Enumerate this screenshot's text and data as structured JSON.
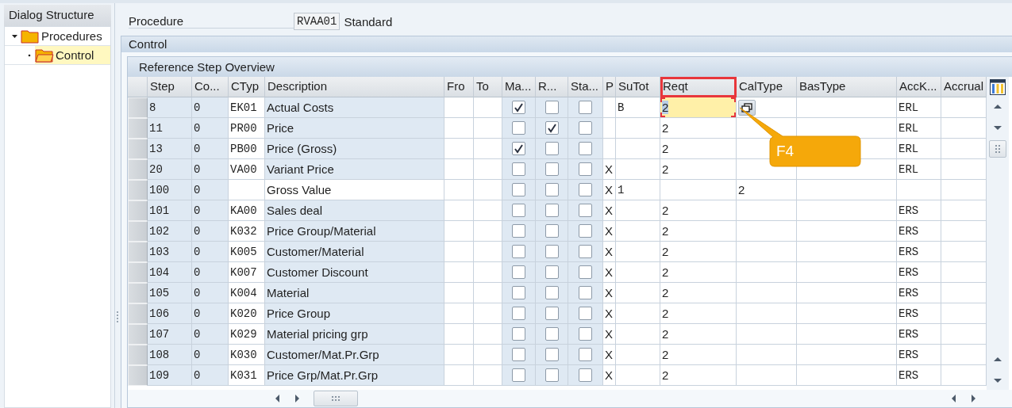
{
  "dialog_structure": {
    "title": "Dialog Structure",
    "items": [
      {
        "label": "Procedures",
        "expanded": true,
        "selected": false,
        "children": [
          {
            "label": "Control",
            "selected": true
          }
        ]
      }
    ]
  },
  "procedure": {
    "label": "Procedure",
    "value": "RVAA01",
    "description": "Standard"
  },
  "section_title": "Control",
  "table": {
    "title": "Reference Step Overview",
    "columns": [
      {
        "label": "Step",
        "kind": "mono",
        "editable": false,
        "highlighted": false
      },
      {
        "label": "Co...",
        "kind": "mono",
        "editable": false,
        "highlighted": false
      },
      {
        "label": "CTyp",
        "kind": "mono",
        "editable": true,
        "highlighted": false
      },
      {
        "label": "Description",
        "kind": "text",
        "editable": false,
        "highlighted": false
      },
      {
        "label": "Fro",
        "kind": "mono",
        "editable": true,
        "highlighted": false
      },
      {
        "label": "To",
        "kind": "mono",
        "editable": true,
        "highlighted": false
      },
      {
        "label": "Ma...",
        "kind": "check",
        "editable": false,
        "highlighted": false
      },
      {
        "label": "R...",
        "kind": "check",
        "editable": false,
        "highlighted": false
      },
      {
        "label": "Sta...",
        "kind": "check",
        "editable": false,
        "highlighted": false
      },
      {
        "label": "P",
        "kind": "text",
        "editable": true,
        "highlighted": false
      },
      {
        "label": "SuTot",
        "kind": "mono",
        "editable": true,
        "highlighted": false
      },
      {
        "label": "Reqt",
        "kind": "text",
        "editable": true,
        "highlighted": true
      },
      {
        "label": "CalType",
        "kind": "text",
        "editable": true,
        "highlighted": false
      },
      {
        "label": "BasType",
        "kind": "text",
        "editable": true,
        "highlighted": false
      },
      {
        "label": "AccK...",
        "kind": "mono",
        "editable": true,
        "highlighted": false
      },
      {
        "label": "Accrual",
        "kind": "text",
        "editable": true,
        "highlighted": false
      }
    ],
    "rows": [
      {
        "step": "8",
        "counter": "0",
        "ctyp": "EK01",
        "description": "Actual Costs",
        "description_editable": false,
        "manual": true,
        "required": false,
        "statistical": false,
        "subtotal": "B",
        "reqt": "2",
        "acckey": "ERL",
        "focused": true
      },
      {
        "step": "11",
        "counter": "0",
        "ctyp": "PR00",
        "description": "Price",
        "description_editable": false,
        "manual": false,
        "required": true,
        "statistical": false,
        "reqt": "2",
        "acckey": "ERL",
        "focused": false
      },
      {
        "step": "13",
        "counter": "0",
        "ctyp": "PB00",
        "description": "Price (Gross)",
        "description_editable": false,
        "manual": true,
        "required": false,
        "statistical": false,
        "reqt": "2",
        "acckey": "ERL",
        "focused": false
      },
      {
        "step": "20",
        "counter": "0",
        "ctyp": "VA00",
        "description": "Variant Price",
        "description_editable": false,
        "manual": false,
        "required": false,
        "statistical": false,
        "print": "X",
        "reqt": "2",
        "acckey": "ERL",
        "focused": false
      },
      {
        "step": "100",
        "counter": "0",
        "description": "Gross Value",
        "description_editable": true,
        "manual": false,
        "required": false,
        "statistical": false,
        "print": "X",
        "subtotal": "1",
        "caltype": "2",
        "focused": false
      },
      {
        "step": "101",
        "counter": "0",
        "ctyp": "KA00",
        "description": "Sales deal",
        "description_editable": false,
        "manual": false,
        "required": false,
        "statistical": false,
        "print": "X",
        "reqt": "2",
        "acckey": "ERS",
        "focused": false
      },
      {
        "step": "102",
        "counter": "0",
        "ctyp": "K032",
        "description": "Price Group/Material",
        "description_editable": false,
        "manual": false,
        "required": false,
        "statistical": false,
        "print": "X",
        "reqt": "2",
        "acckey": "ERS",
        "focused": false
      },
      {
        "step": "103",
        "counter": "0",
        "ctyp": "K005",
        "description": "Customer/Material",
        "description_editable": false,
        "manual": false,
        "required": false,
        "statistical": false,
        "print": "X",
        "reqt": "2",
        "acckey": "ERS",
        "focused": false
      },
      {
        "step": "104",
        "counter": "0",
        "ctyp": "K007",
        "description": "Customer Discount",
        "description_editable": false,
        "manual": false,
        "required": false,
        "statistical": false,
        "print": "X",
        "reqt": "2",
        "acckey": "ERS",
        "focused": false
      },
      {
        "step": "105",
        "counter": "0",
        "ctyp": "K004",
        "description": "Material",
        "description_editable": false,
        "manual": false,
        "required": false,
        "statistical": false,
        "print": "X",
        "reqt": "2",
        "acckey": "ERS",
        "focused": false
      },
      {
        "step": "106",
        "counter": "0",
        "ctyp": "K020",
        "description": "Price Group",
        "description_editable": false,
        "manual": false,
        "required": false,
        "statistical": false,
        "print": "X",
        "reqt": "2",
        "acckey": "ERS",
        "focused": false
      },
      {
        "step": "107",
        "counter": "0",
        "ctyp": "K029",
        "description": "Material pricing grp",
        "description_editable": false,
        "manual": false,
        "required": false,
        "statistical": false,
        "print": "X",
        "reqt": "2",
        "acckey": "ERS",
        "focused": false
      },
      {
        "step": "108",
        "counter": "0",
        "ctyp": "K030",
        "description": "Customer/Mat.Pr.Grp",
        "description_editable": false,
        "manual": false,
        "required": false,
        "statistical": false,
        "print": "X",
        "reqt": "2",
        "acckey": "ERS",
        "focused": false
      },
      {
        "step": "109",
        "counter": "0",
        "ctyp": "K031",
        "description": "Price Grp/Mat.Pr.Grp",
        "description_editable": false,
        "manual": false,
        "required": false,
        "statistical": false,
        "print": "X",
        "reqt": "2",
        "acckey": "ERS",
        "focused": false
      }
    ]
  },
  "callout": {
    "text": "F4"
  }
}
